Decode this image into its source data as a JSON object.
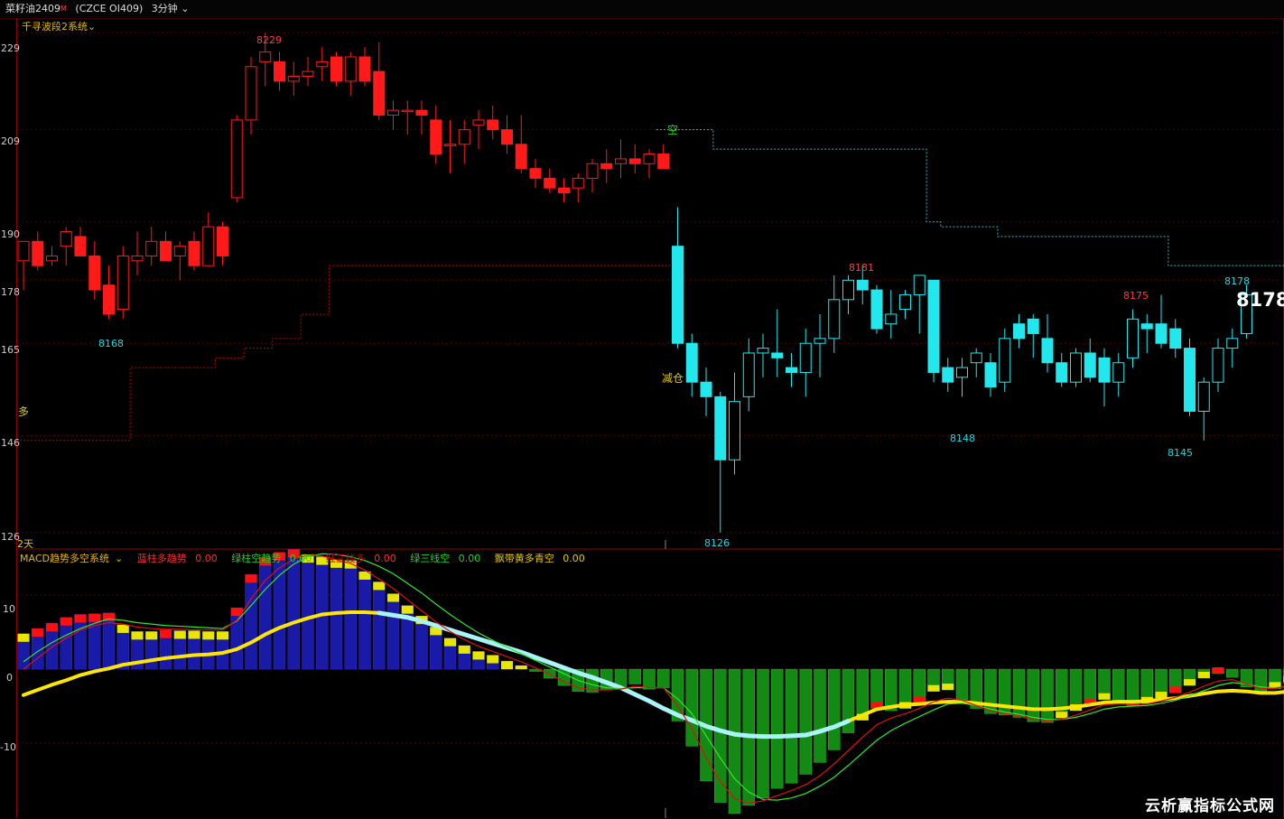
{
  "topbar": {
    "symbol": "菜籽油2409",
    "sup": "M",
    "code": "(CZCE OI409)",
    "period": "3分钟"
  },
  "price_panel": {
    "indicator_title": "千寻波段2系统",
    "y_ticks": [
      "229",
      "209",
      "190",
      "178",
      "165",
      "146",
      "126"
    ],
    "footer_label": "2天",
    "marker_long": "多",
    "marker_short": "空",
    "marker_reduce": "减仓",
    "last_price_big": "8178",
    "last_price_small": "8178",
    "annotations": [
      {
        "text": "8229",
        "color": "#ff3b3b"
      },
      {
        "text": "8168",
        "color": "#22d6e0"
      },
      {
        "text": "8181",
        "color": "#ff3b3b"
      },
      {
        "text": "8175",
        "color": "#ff3b3b"
      },
      {
        "text": "8148",
        "color": "#22d6e0"
      },
      {
        "text": "8145",
        "color": "#22d6e0"
      },
      {
        "text": "8126",
        "color": "#22d6e0"
      }
    ]
  },
  "macd_panel": {
    "title": "MACD趋势多空系统",
    "legend": [
      {
        "label": "蓝柱多趋势",
        "value": "0.00",
        "color": "#ff2a2a"
      },
      {
        "label": "绿柱空趋势",
        "value": "0.00",
        "color": "#1ed61e"
      },
      {
        "label": "红三线多",
        "value": "0.00",
        "color": "#c40000"
      },
      {
        "label": "绿三线空",
        "value": "0.00",
        "color": "#1ed61e"
      },
      {
        "label": "飘带黄多青空",
        "value": "0.00",
        "color": "#e6c800"
      }
    ],
    "y_ticks": [
      "10",
      "0",
      "-10"
    ]
  },
  "watermark": "云析赢指标公式网",
  "chart_data": [
    {
      "type": "candlestick",
      "title": "菜籽油2409 (CZCE OI409) 3分钟",
      "ylim": [
        8123,
        8232
      ],
      "up_color": "#ff0000",
      "down_color_bull_phase": "#ff0000",
      "bear_color": "#22e8ee",
      "candles": [
        {
          "o": 8182,
          "h": 8186,
          "l": 8176,
          "c": 8186
        },
        {
          "o": 8186,
          "h": 8188,
          "l": 8180,
          "c": 8181
        },
        {
          "o": 8182,
          "h": 8185,
          "l": 8181,
          "c": 8183
        },
        {
          "o": 8185,
          "h": 8189,
          "l": 8181,
          "c": 8188
        },
        {
          "o": 8187,
          "h": 8189,
          "l": 8183,
          "c": 8183
        },
        {
          "o": 8183,
          "h": 8186,
          "l": 8174,
          "c": 8176
        },
        {
          "o": 8177,
          "h": 8181,
          "l": 8170,
          "c": 8171
        },
        {
          "o": 8172,
          "h": 8185,
          "l": 8170,
          "c": 8183
        },
        {
          "o": 8182,
          "h": 8188,
          "l": 8179,
          "c": 8183
        },
        {
          "o": 8183,
          "h": 8189,
          "l": 8181,
          "c": 8186
        },
        {
          "o": 8186,
          "h": 8188,
          "l": 8182,
          "c": 8182
        },
        {
          "o": 8183,
          "h": 8186,
          "l": 8178,
          "c": 8185
        },
        {
          "o": 8186,
          "h": 8188,
          "l": 8180,
          "c": 8181
        },
        {
          "o": 8181,
          "h": 8192,
          "l": 8181,
          "c": 8189
        },
        {
          "o": 8189,
          "h": 8190,
          "l": 8181,
          "c": 8183
        },
        {
          "o": 8195,
          "h": 8212,
          "l": 8194,
          "c": 8211
        },
        {
          "o": 8211,
          "h": 8224,
          "l": 8208,
          "c": 8222
        },
        {
          "o": 8223,
          "h": 8229,
          "l": 8218,
          "c": 8225
        },
        {
          "o": 8223,
          "h": 8225,
          "l": 8217,
          "c": 8219
        },
        {
          "o": 8219,
          "h": 8223,
          "l": 8216,
          "c": 8220
        },
        {
          "o": 8220,
          "h": 8224,
          "l": 8218,
          "c": 8221
        },
        {
          "o": 8222,
          "h": 8226,
          "l": 8219,
          "c": 8223
        },
        {
          "o": 8224,
          "h": 8225,
          "l": 8218,
          "c": 8219
        },
        {
          "o": 8219,
          "h": 8225,
          "l": 8216,
          "c": 8224
        },
        {
          "o": 8224,
          "h": 8226,
          "l": 8218,
          "c": 8219
        },
        {
          "o": 8221,
          "h": 8227,
          "l": 8211,
          "c": 8212
        },
        {
          "o": 8212,
          "h": 8215,
          "l": 8209,
          "c": 8213
        },
        {
          "o": 8213,
          "h": 8215,
          "l": 8208,
          "c": 8213
        },
        {
          "o": 8213,
          "h": 8215,
          "l": 8208,
          "c": 8212
        },
        {
          "o": 8211,
          "h": 8214,
          "l": 8202,
          "c": 8204
        },
        {
          "o": 8206,
          "h": 8211,
          "l": 8200,
          "c": 8206
        },
        {
          "o": 8206,
          "h": 8211,
          "l": 8202,
          "c": 8209
        },
        {
          "o": 8210,
          "h": 8213,
          "l": 8205,
          "c": 8211
        },
        {
          "o": 8211,
          "h": 8214,
          "l": 8207,
          "c": 8209
        },
        {
          "o": 8209,
          "h": 8212,
          "l": 8204,
          "c": 8206
        },
        {
          "o": 8206,
          "h": 8212,
          "l": 8200,
          "c": 8201
        },
        {
          "o": 8201,
          "h": 8203,
          "l": 8197,
          "c": 8199
        },
        {
          "o": 8199,
          "h": 8201,
          "l": 8196,
          "c": 8197
        },
        {
          "o": 8197,
          "h": 8199,
          "l": 8194,
          "c": 8196
        },
        {
          "o": 8197,
          "h": 8200,
          "l": 8194,
          "c": 8199
        },
        {
          "o": 8199,
          "h": 8203,
          "l": 8196,
          "c": 8202
        },
        {
          "o": 8202,
          "h": 8205,
          "l": 8198,
          "c": 8201
        },
        {
          "o": 8202,
          "h": 8207,
          "l": 8199,
          "c": 8203
        },
        {
          "o": 8203,
          "h": 8206,
          "l": 8200,
          "c": 8202
        },
        {
          "o": 8202,
          "h": 8205,
          "l": 8199,
          "c": 8204
        },
        {
          "o": 8204,
          "h": 8206,
          "l": 8201,
          "c": 8201
        },
        {
          "o": 8185,
          "h": 8193,
          "l": 8164,
          "c": 8165
        },
        {
          "o": 8165,
          "h": 8167,
          "l": 8154,
          "c": 8157
        },
        {
          "o": 8157,
          "h": 8160,
          "l": 8150,
          "c": 8154
        },
        {
          "o": 8154,
          "h": 8155,
          "l": 8126,
          "c": 8141
        },
        {
          "o": 8141,
          "h": 8159,
          "l": 8138,
          "c": 8153
        },
        {
          "o": 8154,
          "h": 8166,
          "l": 8151,
          "c": 8163
        },
        {
          "o": 8163,
          "h": 8167,
          "l": 8158,
          "c": 8164
        },
        {
          "o": 8163,
          "h": 8172,
          "l": 8158,
          "c": 8162
        },
        {
          "o": 8160,
          "h": 8163,
          "l": 8156,
          "c": 8159
        },
        {
          "o": 8159,
          "h": 8168,
          "l": 8154,
          "c": 8165
        },
        {
          "o": 8165,
          "h": 8171,
          "l": 8158,
          "c": 8166
        },
        {
          "o": 8166,
          "h": 8179,
          "l": 8163,
          "c": 8174
        },
        {
          "o": 8174,
          "h": 8179,
          "l": 8171,
          "c": 8178
        },
        {
          "o": 8178,
          "h": 8181,
          "l": 8173,
          "c": 8176
        },
        {
          "o": 8176,
          "h": 8177,
          "l": 8167,
          "c": 8168
        },
        {
          "o": 8169,
          "h": 8176,
          "l": 8166,
          "c": 8171
        },
        {
          "o": 8172,
          "h": 8176,
          "l": 8170,
          "c": 8175
        },
        {
          "o": 8175,
          "h": 8179,
          "l": 8167,
          "c": 8179
        },
        {
          "o": 8178,
          "h": 8178,
          "l": 8157,
          "c": 8159
        },
        {
          "o": 8160,
          "h": 8162,
          "l": 8155,
          "c": 8157
        },
        {
          "o": 8158,
          "h": 8162,
          "l": 8154,
          "c": 8160
        },
        {
          "o": 8161,
          "h": 8164,
          "l": 8158,
          "c": 8163
        },
        {
          "o": 8161,
          "h": 8163,
          "l": 8154,
          "c": 8156
        },
        {
          "o": 8157,
          "h": 8168,
          "l": 8155,
          "c": 8166
        },
        {
          "o": 8169,
          "h": 8171,
          "l": 8164,
          "c": 8166
        },
        {
          "o": 8170,
          "h": 8171,
          "l": 8162,
          "c": 8167
        },
        {
          "o": 8166,
          "h": 8171,
          "l": 8159,
          "c": 8161
        },
        {
          "o": 8161,
          "h": 8163,
          "l": 8156,
          "c": 8157
        },
        {
          "o": 8157,
          "h": 8164,
          "l": 8156,
          "c": 8163
        },
        {
          "o": 8163,
          "h": 8166,
          "l": 8157,
          "c": 8158
        },
        {
          "o": 8162,
          "h": 8164,
          "l": 8152,
          "c": 8157
        },
        {
          "o": 8157,
          "h": 8163,
          "l": 8154,
          "c": 8161
        },
        {
          "o": 8162,
          "h": 8172,
          "l": 8160,
          "c": 8170
        },
        {
          "o": 8169,
          "h": 8171,
          "l": 8163,
          "c": 8168
        },
        {
          "o": 8169,
          "h": 8175,
          "l": 8164,
          "c": 8165
        },
        {
          "o": 8168,
          "h": 8170,
          "l": 8162,
          "c": 8164
        },
        {
          "o": 8164,
          "h": 8166,
          "l": 8150,
          "c": 8151
        },
        {
          "o": 8151,
          "h": 8158,
          "l": 8145,
          "c": 8157
        },
        {
          "o": 8157,
          "h": 8166,
          "l": 8155,
          "c": 8164
        },
        {
          "o": 8164,
          "h": 8168,
          "l": 8160,
          "c": 8166
        },
        {
          "o": 8167,
          "h": 8177,
          "l": 8166,
          "c": 8175
        }
      ],
      "overlays": {
        "long_stop_line": [
          8145,
          8145,
          8145,
          8145,
          8145,
          8145,
          8145,
          8145,
          8160,
          8160,
          8160,
          8160,
          8160,
          8160,
          8162,
          8162,
          8164,
          8164,
          8166,
          8166,
          8171,
          8171,
          8181,
          8181,
          8181,
          8181,
          8181,
          8181,
          8181,
          8181,
          8181,
          8181,
          8181,
          8181,
          8181,
          8181,
          8181,
          8181,
          8181,
          8181,
          8181,
          8181,
          8181,
          8181,
          8181,
          8181
        ],
        "short_stop_line_start_index": 45,
        "short_stop_line": [
          8209,
          8209,
          8209,
          8209,
          8205,
          8205,
          8205,
          8205,
          8205,
          8205,
          8205,
          8205,
          8205,
          8205,
          8205,
          8205,
          8205,
          8205,
          8205,
          8190,
          8189,
          8189,
          8189,
          8189,
          8187,
          8187,
          8187,
          8187,
          8187,
          8187,
          8187,
          8187,
          8187,
          8187,
          8187,
          8187,
          8181,
          8181,
          8181,
          8181,
          8181,
          8181,
          8181,
          8181,
          8181,
          8181,
          8181,
          8178,
          8178,
          8178,
          8178,
          8178,
          8178
        ]
      }
    },
    {
      "type": "bar",
      "title": "MACD趋势多空系统",
      "ylim": [
        -20,
        16
      ],
      "histogram": [
        4.8,
        5.5,
        6.2,
        7.0,
        7.4,
        7.5,
        7.6,
        6.0,
        5.1,
        5.1,
        5.3,
        5.2,
        5.2,
        5.1,
        5.1,
        8.3,
        12.8,
        15.1,
        15.8,
        16.2,
        15.5,
        15.2,
        14.8,
        14.7,
        13.2,
        11.8,
        10.2,
        8.6,
        7.2,
        5.7,
        4.2,
        3.2,
        2.4,
        1.9,
        1.1,
        0.5,
        -0.3,
        -1.2,
        -2.2,
        -3.0,
        -3.1,
        -2.8,
        -2.7,
        -2.0,
        -2.7,
        -2.5,
        -7.0,
        -10.4,
        -15.1,
        -18.0,
        -19.5,
        -18.4,
        -17.4,
        -16.1,
        -15.4,
        -14.2,
        -12.6,
        -10.9,
        -8.6,
        -6.9,
        -5.3,
        -5.6,
        -5.3,
        -4.5,
        -3.0,
        -2.8,
        -4.1,
        -5.3,
        -6.0,
        -6.2,
        -6.5,
        -7.1,
        -7.2,
        -6.6,
        -5.6,
        -4.9,
        -4.1,
        -4.6,
        -4.9,
        -4.6,
        -3.9,
        -3.2,
        -2.2,
        -1.2,
        -0.6,
        -1.1,
        -2.4,
        -3.1,
        -2.6,
        -1.8,
        -0.4
      ],
      "series": [
        {
          "name": "飘带黄多青空",
          "values": [
            -3.5,
            -2.8,
            -2.1,
            -1.5,
            -0.8,
            -0.3,
            0.1,
            0.6,
            0.9,
            1.2,
            1.5,
            1.7,
            1.9,
            2.0,
            2.2,
            2.7,
            3.6,
            4.7,
            5.6,
            6.3,
            6.9,
            7.4,
            7.6,
            7.7,
            7.7,
            7.6,
            7.3,
            7.0,
            6.5,
            5.9,
            5.3,
            4.7,
            4.1,
            3.5,
            2.9,
            2.3,
            1.6,
            0.9,
            0.2,
            -0.5,
            -1.1,
            -1.8,
            -2.5,
            -3.4,
            -4.3,
            -5.3,
            -6.2,
            -6.9,
            -7.7,
            -8.3,
            -8.8,
            -9.0,
            -9.1,
            -9.1,
            -9.0,
            -8.9,
            -8.4,
            -7.8,
            -7.0,
            -6.2,
            -5.4,
            -5.1,
            -4.8,
            -4.7,
            -4.5,
            -4.4,
            -4.4,
            -4.6,
            -4.8,
            -5.0,
            -5.2,
            -5.4,
            -5.4,
            -5.3,
            -5.1,
            -4.8,
            -4.5,
            -4.4,
            -4.4,
            -4.3,
            -4.1,
            -3.9,
            -3.6,
            -3.3,
            -3.0,
            -2.9,
            -3.0,
            -3.2,
            -3.2,
            -3.0,
            -2.8
          ]
        },
        {
          "name": "红三线多",
          "values": [
            0.0,
            1.5,
            3.0,
            4.2,
            5.3,
            5.9,
            6.3,
            6.1,
            5.7,
            5.5,
            5.4,
            5.4,
            5.3,
            5.3,
            5.3,
            6.6,
            9.5,
            12.0,
            13.7,
            14.9,
            15.4,
            15.3,
            14.8,
            14.3,
            13.4,
            12.2,
            10.9,
            9.4,
            7.9,
            6.4,
            5.1,
            4.0,
            3.1,
            2.4,
            1.7,
            1.0,
            0.2,
            -0.7,
            -1.7,
            -2.5,
            -2.8,
            -2.8,
            -2.7,
            -2.3,
            -2.5,
            -2.5,
            -5.0,
            -8.0,
            -12.0,
            -15.2,
            -17.5,
            -18.1,
            -17.8,
            -17.1,
            -16.4,
            -15.6,
            -14.4,
            -12.8,
            -11.0,
            -9.2,
            -7.5,
            -6.6,
            -6.0,
            -5.3,
            -4.4,
            -3.9,
            -4.2,
            -4.9,
            -5.6,
            -6.0,
            -6.3,
            -6.8,
            -7.0,
            -6.8,
            -6.2,
            -5.5,
            -4.8,
            -4.7,
            -4.8,
            -4.7,
            -4.3,
            -3.8,
            -3.1,
            -2.3,
            -1.6,
            -1.4,
            -2.0,
            -2.6,
            -2.6,
            -2.2,
            -1.4
          ]
        },
        {
          "name": "绿三线空",
          "values": [
            1.0,
            2.4,
            3.6,
            4.6,
            5.5,
            6.2,
            6.8,
            6.6,
            6.3,
            6.1,
            5.9,
            5.8,
            5.7,
            5.6,
            5.5,
            6.5,
            8.6,
            10.8,
            12.7,
            14.2,
            15.2,
            15.6,
            15.5,
            15.2,
            14.7,
            13.9,
            12.9,
            11.6,
            10.3,
            8.8,
            7.4,
            6.1,
            4.9,
            3.9,
            3.0,
            2.1,
            1.2,
            0.3,
            -0.6,
            -1.5,
            -2.1,
            -2.5,
            -2.6,
            -2.5,
            -2.5,
            -2.5,
            -4.0,
            -6.0,
            -9.0,
            -12.0,
            -14.8,
            -16.6,
            -17.6,
            -17.7,
            -17.4,
            -16.8,
            -15.8,
            -14.6,
            -13.0,
            -11.3,
            -9.6,
            -8.3,
            -7.3,
            -6.4,
            -5.5,
            -4.7,
            -4.6,
            -4.9,
            -5.4,
            -5.8,
            -6.1,
            -6.5,
            -6.8,
            -6.8,
            -6.5,
            -6.0,
            -5.4,
            -5.1,
            -5.0,
            -4.9,
            -4.6,
            -4.2,
            -3.6,
            -2.9,
            -2.2,
            -1.8,
            -2.0,
            -2.4,
            -2.5,
            -2.3,
            -1.8
          ]
        }
      ]
    }
  ]
}
